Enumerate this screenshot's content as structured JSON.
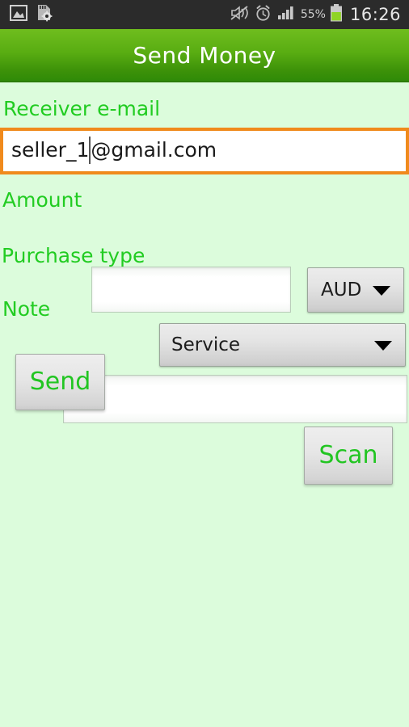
{
  "status_bar": {
    "left_icons": [
      {
        "name": "gallery-image-icon",
        "label": "Screenshot captured"
      },
      {
        "name": "sd-card-settings-icon",
        "label": "SD card settings"
      }
    ],
    "right_icons": [
      {
        "name": "sound-mute-icon",
        "label": "Sound muted"
      },
      {
        "name": "alarm-clock-icon",
        "label": "Alarm set"
      },
      {
        "name": "signal-bars-icon",
        "label": "Signal strength"
      },
      {
        "name": "battery-icon",
        "label": "Battery"
      }
    ],
    "battery_percent": "55%",
    "clock": "16:26"
  },
  "header": {
    "title": "Send Money"
  },
  "form": {
    "email": {
      "label": "Receiver e-mail",
      "value_before_caret": "seller_1",
      "value_after_caret": "@gmail.com",
      "full_value": "seller_1@gmail.com",
      "focused": true,
      "focus_border_color": "#f08a1c"
    },
    "amount": {
      "label": "Amount",
      "value": "",
      "placeholder": ""
    },
    "currency": {
      "selected": "AUD"
    },
    "purchase_type": {
      "label": "Purchase type",
      "selected": "Service"
    },
    "note": {
      "label": "Note",
      "value": "",
      "placeholder": ""
    }
  },
  "buttons": {
    "send": "Send",
    "scan": "Scan"
  },
  "colors": {
    "page_background": "#dcfcdc",
    "header_gradient_top": "#6fbd1e",
    "header_gradient_bottom": "#2f8a08",
    "label_green": "#22cc22",
    "button_text_green": "#22c522",
    "focus_orange": "#f08a1c",
    "status_bar_background": "#2b2b2b"
  }
}
